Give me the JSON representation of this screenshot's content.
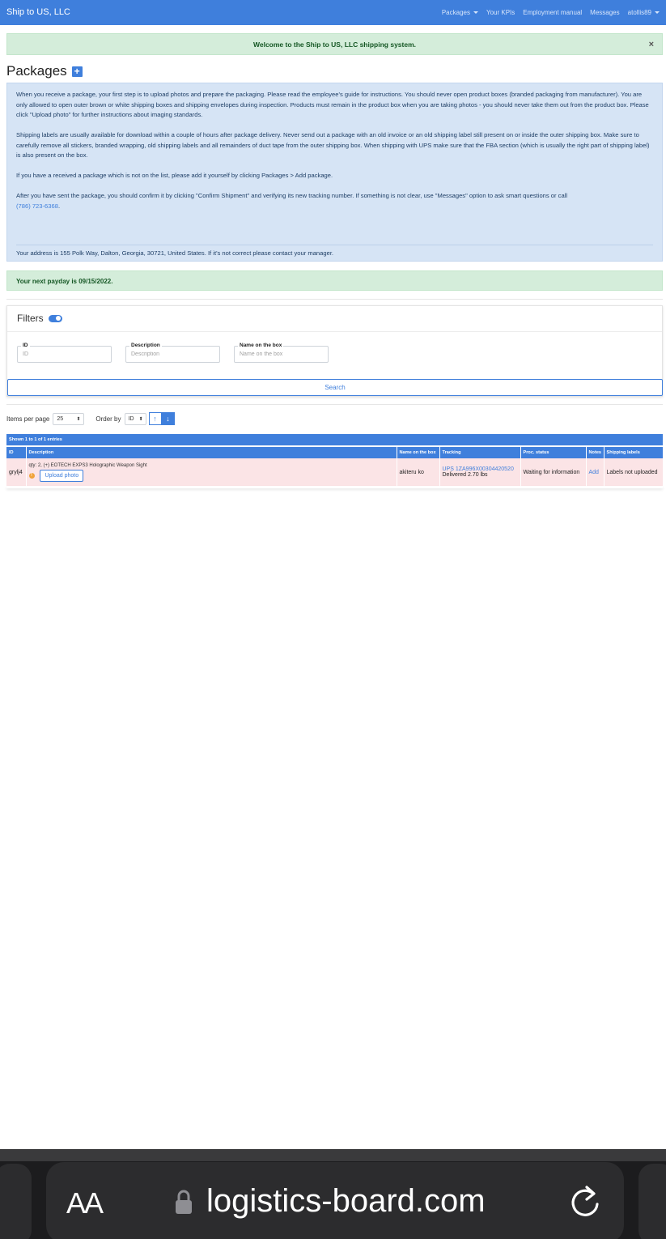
{
  "navbar": {
    "brand": "Ship to US, LLC",
    "links": [
      "Packages",
      "Your KPIs",
      "Employment manual",
      "Messages",
      "atollis89"
    ]
  },
  "welcome": {
    "text": "Welcome to the Ship to US, LLC shipping system.",
    "close": "×"
  },
  "page": {
    "title": "Packages",
    "add_icon": "+"
  },
  "info": {
    "p1": "When you receive a package, your first step is to upload photos and prepare the packaging. Please read the employee's guide for instructions. You should never open product boxes (branded packaging from manufacturer). You are only allowed to open outer brown or white shipping boxes and shipping envelopes during inspection. Products must remain in the product box when you are taking photos - you should never take them out from the product box. Please click \"Upload photo\" for further instructions about imaging standards.",
    "p2": "Shipping labels are usually available for download within a couple of hours after package delivery. Never send out a package with an old invoice or an old shipping label still present on or inside the outer shipping box. Make sure to carefully remove all stickers, branded wrapping, old shipping labels and all remainders of duct tape from the outer shipping box. When shipping with UPS make sure that the FBA section (which is usually the right part of shipping label) is also present on the box.",
    "p3": "If you have a received a package which is not on the list, please add it yourself by clicking Packages > Add package.",
    "p4": "After you have sent the package, you should confirm it by clicking \"Confirm Shipment\" and verifying its new tracking number. If something is not clear, use \"Messages\" option to ask smart questions or call",
    "phone": "(786) 723-6368",
    "p4_end": ".",
    "address": "Your address is 155 Polk Way, Dalton, Georgia, 30721, United States. If it's not correct please contact your manager."
  },
  "payday": "Your next payday is 09/15/2022.",
  "filters": {
    "title": "Filters",
    "fields": [
      {
        "label": "ID",
        "placeholder": "ID"
      },
      {
        "label": "Description",
        "placeholder": "Description"
      },
      {
        "label": "Name on the box",
        "placeholder": "Name on the box"
      }
    ],
    "search_label": "Search"
  },
  "controls": {
    "items_per_page_label": "Items per page",
    "items_per_page_value": "25",
    "order_by_label": "Order by",
    "order_by_value": "ID",
    "asc_icon": "↑",
    "desc_icon": "↓"
  },
  "table": {
    "shown": "Shown 1 to 1 of 1 entries",
    "headers": [
      "ID",
      "Description",
      "Name on the box",
      "Tracking",
      "Proc. status",
      "Notes",
      "Shipping labels"
    ],
    "rows": [
      {
        "id": "grylj4",
        "description": "qty: 2, (+) EOTECH EXPS3 Holographic Weapon Sight",
        "upload": "Upload photo",
        "name_on_box": "akiteru ko",
        "tracking": "UPS 1ZA996X00304420520",
        "tracking_status": "Delivered 2.70 lbs",
        "proc_status": "Waiting for information",
        "notes": "Add",
        "shipping_labels": "Labels not uploaded"
      }
    ]
  },
  "browser": {
    "aa": "AA",
    "url": "logistics-board.com"
  },
  "colors": {
    "primary": "#3f7fdc",
    "success_bg": "#d4edda",
    "info_bg": "#d6e4f5",
    "row_bg": "#fbe4e6"
  }
}
